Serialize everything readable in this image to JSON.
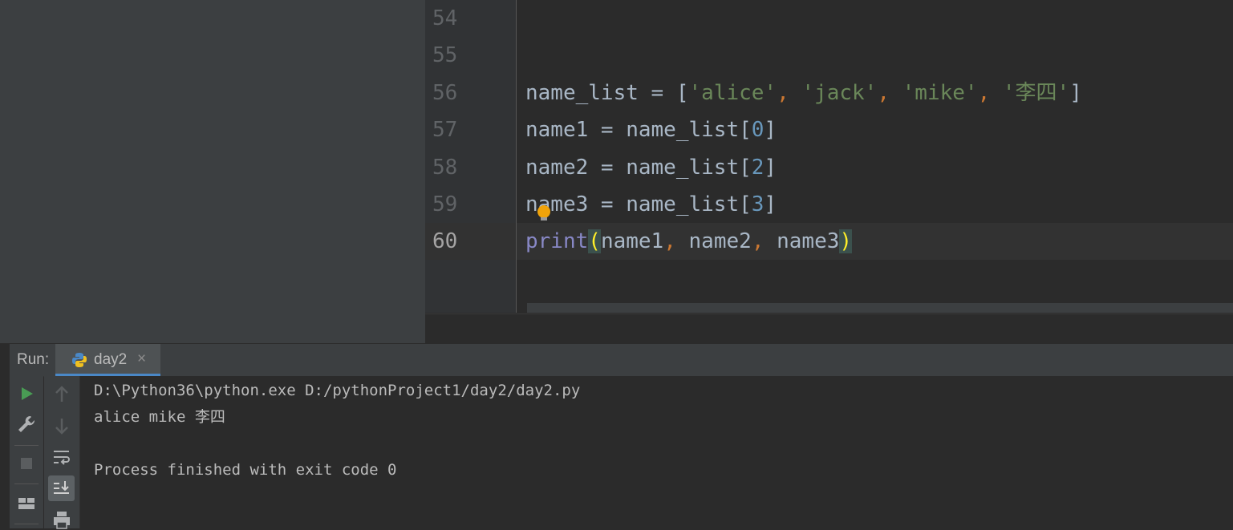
{
  "editor": {
    "line_numbers": [
      "54",
      "55",
      "56",
      "57",
      "58",
      "59",
      "60"
    ],
    "lines": {
      "l56": {
        "var": "name_list",
        "eq": " = ",
        "open": "[",
        "s1": "'alice'",
        "c1": ", ",
        "s2": "'jack'",
        "c2": ", ",
        "s3": "'mike'",
        "c3": ", ",
        "s4": "'李四'",
        "close": "]"
      },
      "l57": {
        "lhs": "name1 = name_list[",
        "idx": "0",
        "close": "]"
      },
      "l58": {
        "lhs": "name2 = name_list[",
        "idx": "2",
        "close": "]"
      },
      "l59": {
        "lhs": "name3 = name_list[",
        "idx": "3",
        "close": "]"
      },
      "l60": {
        "fn": "print",
        "open": "(",
        "a1": "name1",
        "c1": ", ",
        "a2": "name2",
        "c2": ", ",
        "a3": "name3",
        "close": ")"
      }
    }
  },
  "run_panel": {
    "label": "Run:",
    "tab": {
      "label": "day2",
      "close": "×"
    },
    "output": [
      "D:\\Python36\\python.exe D:/pythonProject1/day2/day2.py",
      "alice mike 李四",
      "",
      "Process finished with exit code 0"
    ]
  },
  "icons": [
    "run-icon",
    "wrench-icon",
    "stop-icon",
    "layout-icon",
    "up-arrow-icon",
    "down-arrow-icon",
    "soft-wrap-icon",
    "scroll-to-end-icon",
    "print-icon",
    "python-icon",
    "lightbulb-icon"
  ],
  "colors": {
    "string": "#6a8759",
    "number": "#6897bb",
    "builtin": "#8888c6",
    "comma": "#cc7832",
    "text": "#a9b7c6",
    "run_green": "#499c54",
    "bracket_match": "#ffef28"
  }
}
